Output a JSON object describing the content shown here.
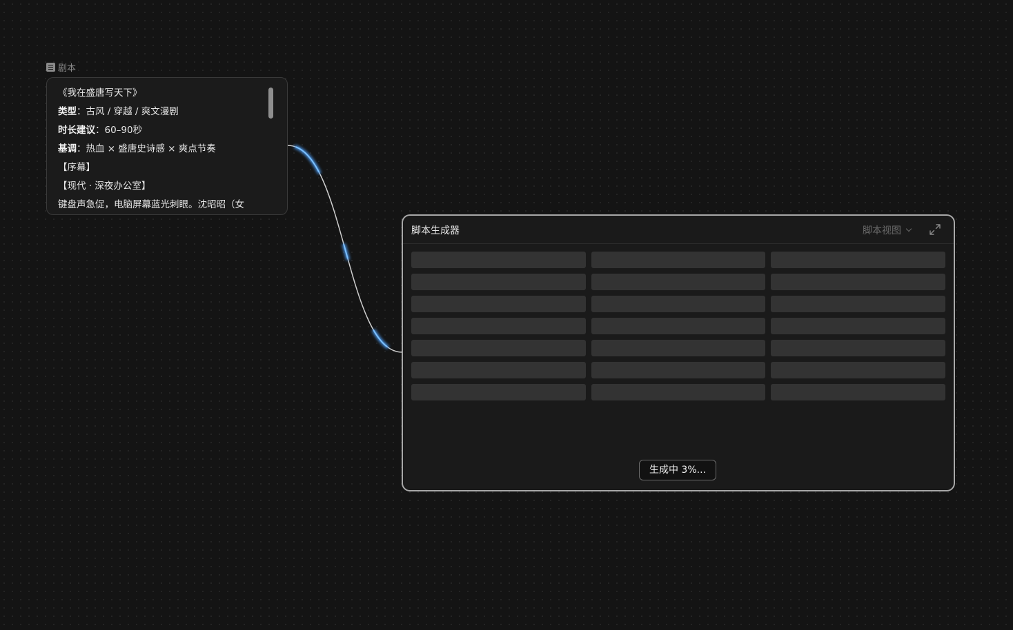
{
  "script_node": {
    "label": "剧本",
    "lines": [
      {
        "bold": "",
        "text": "《我在盛唐写天下》"
      },
      {
        "bold": "类型",
        "text": "：古风 / 穿越 / 爽文漫剧"
      },
      {
        "bold": "时长建议",
        "text": "：60–90秒"
      },
      {
        "bold": "基调",
        "text": "：热血 × 盛唐史诗感 × 爽点节奏"
      },
      {
        "bold": "",
        "text": "【序幕】"
      },
      {
        "bold": "",
        "text": "【现代 · 深夜办公室】"
      },
      {
        "bold": "",
        "text": "键盘声急促，电脑屏幕蓝光刺眼。沈昭昭（女"
      }
    ]
  },
  "generator": {
    "title": "脚本生成器",
    "view_label": "脚本视图",
    "progress_label": "生成中 3%...",
    "progress_percent": 3
  },
  "colors": {
    "background": "#141414",
    "edge_glow": "#4fa3ff",
    "edge_line": "#cfcfcf"
  }
}
